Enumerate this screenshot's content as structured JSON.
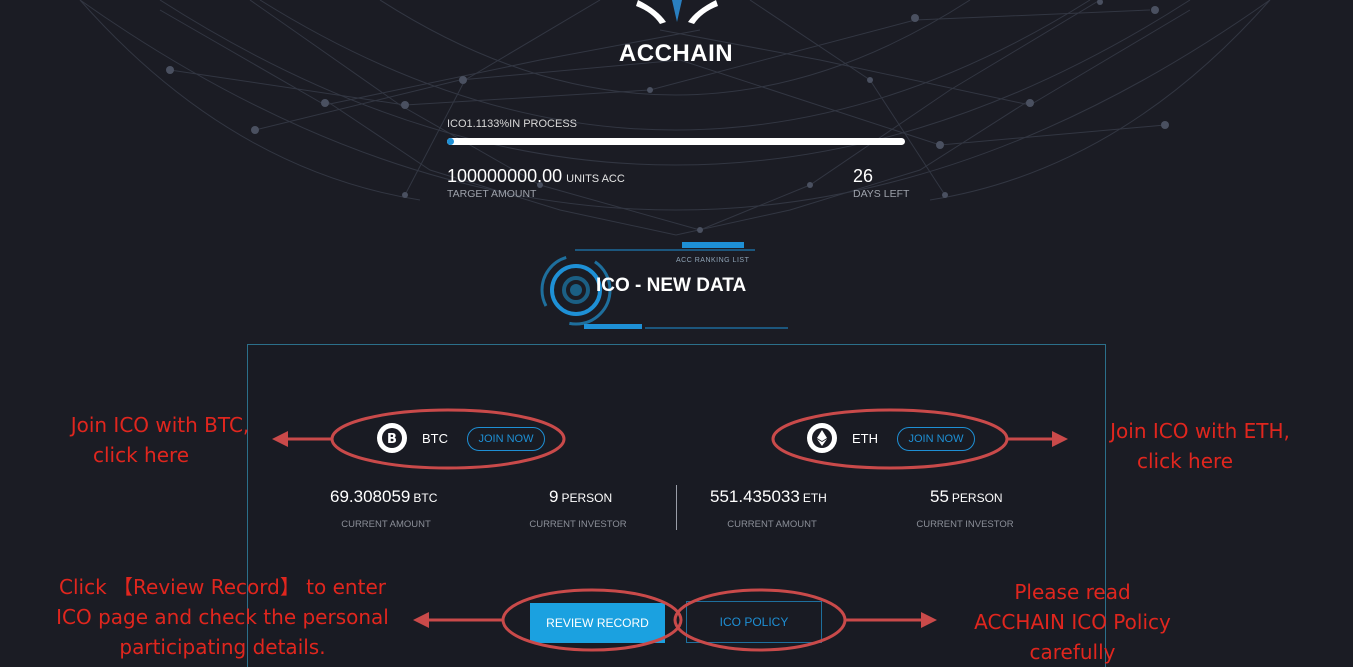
{
  "brand": {
    "name": "ACCHAIN"
  },
  "progress": {
    "label": "ICO1.1133%IN PROCESS",
    "percent": 1.1133
  },
  "target": {
    "amount": "100000000.00",
    "unit": "UNITS ACC",
    "caption": "TARGET AMOUNT"
  },
  "days": {
    "value": "26",
    "caption": "DAYS LEFT"
  },
  "section": {
    "subtitle": "ACC RANKING LIST",
    "title": "ICO - NEW DATA"
  },
  "btc": {
    "name": "BTC",
    "join_label": "JOIN NOW",
    "amount": "69.308059",
    "amount_unit": "BTC",
    "amount_caption": "CURRENT AMOUNT",
    "investors": "9",
    "investors_unit": "PERSON",
    "investors_caption": "CURRENT INVESTOR"
  },
  "eth": {
    "name": "ETH",
    "join_label": "JOIN NOW",
    "amount": "551.435033",
    "amount_unit": "ETH",
    "amount_caption": "CURRENT AMOUNT",
    "investors": "55",
    "investors_unit": "PERSON",
    "investors_caption": "CURRENT INVESTOR"
  },
  "actions": {
    "review_label": "REVIEW RECORD",
    "policy_label": "ICO POLICY"
  },
  "annotations": {
    "btc_line1": "Join ICO with BTC,",
    "btc_line2": "click here",
    "eth_line1": "Join ICO with ETH,",
    "eth_line2": "click here",
    "review_line1": "Click 【Review Record】 to enter",
    "review_line2": "ICO page and check the personal",
    "review_line3": "participating details.",
    "policy_line1": "Please read",
    "policy_line2": "ACCHAIN ICO Policy",
    "policy_line3": "carefully"
  },
  "colors": {
    "background": "#1b1c24",
    "accent": "#1e90d6",
    "annotation": "#e0261e",
    "panel_border": "#2b6f8a"
  },
  "icons": {
    "btc": "bitcoin-icon",
    "eth": "ethereum-icon",
    "logo": "acchain-logo-icon"
  }
}
